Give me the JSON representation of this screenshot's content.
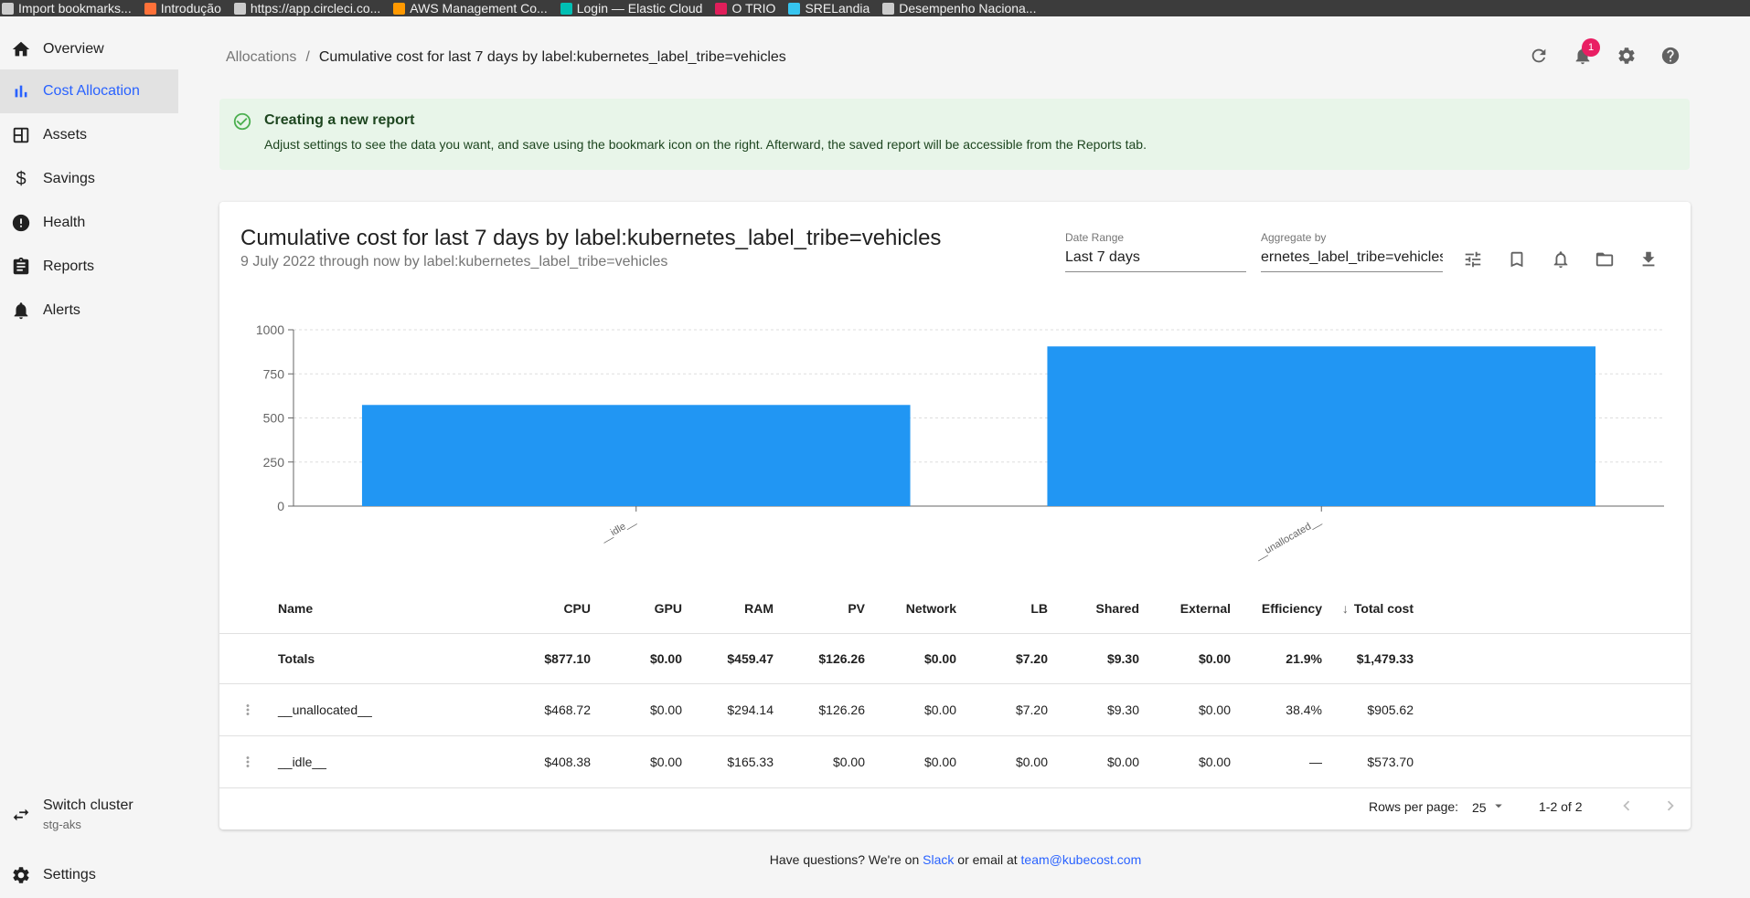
{
  "bookmarks": [
    {
      "label": "Import bookmarks...",
      "icon": "import-icon",
      "color": "#cccccc"
    },
    {
      "label": "Introdução",
      "icon": "firefox-icon",
      "color": "#ff7139"
    },
    {
      "label": "https://app.circleci.co...",
      "icon": "globe-icon",
      "color": "#cccccc"
    },
    {
      "label": "AWS Management Co...",
      "icon": "aws-icon",
      "color": "#ff9900"
    },
    {
      "label": "Login — Elastic Cloud",
      "icon": "elastic-icon",
      "color": "#00bfb3"
    },
    {
      "label": "O TRIO",
      "icon": "slack-icon",
      "color": "#e01e5a"
    },
    {
      "label": "SRELandia",
      "icon": "slack-icon",
      "color": "#36c5f0"
    },
    {
      "label": "Desempenho Naciona...",
      "icon": "globe-icon",
      "color": "#cccccc"
    }
  ],
  "sidebar": {
    "items": [
      {
        "label": "Overview",
        "icon": "home-icon"
      },
      {
        "label": "Cost Allocation",
        "icon": "bar-chart-icon",
        "active": true
      },
      {
        "label": "Assets",
        "icon": "assets-icon"
      },
      {
        "label": "Savings",
        "icon": "dollar-icon"
      },
      {
        "label": "Health",
        "icon": "alert-circle-icon"
      },
      {
        "label": "Reports",
        "icon": "clipboard-icon"
      },
      {
        "label": "Alerts",
        "icon": "bell-icon"
      }
    ],
    "switch_cluster": {
      "label": "Switch cluster",
      "cluster": "stg-aks"
    },
    "settings_label": "Settings"
  },
  "breadcrumb": {
    "parent": "Allocations",
    "separator": "/",
    "current": "Cumulative cost for last 7 days by label:kubernetes_label_tribe=vehicles"
  },
  "notifications": {
    "count": "1"
  },
  "alert": {
    "title": "Creating a new report",
    "body": "Adjust settings to see the data you want, and save using the bookmark icon on the right. Afterward, the saved report will be accessible from the Reports tab."
  },
  "report": {
    "title": "Cumulative cost for last 7 days by label:kubernetes_label_tribe=vehicles",
    "subtitle": "9 July 2022 through now by label:kubernetes_label_tribe=vehicles",
    "date_range": {
      "label": "Date Range",
      "value": "Last 7 days"
    },
    "aggregate": {
      "label": "Aggregate by",
      "value": "ernetes_label_tribe=vehicles"
    }
  },
  "chart_data": {
    "type": "bar",
    "categories": [
      "__idle__",
      "__unallocated__"
    ],
    "values": [
      573.7,
      905.62
    ],
    "ylim": [
      0,
      1000
    ],
    "yticks": [
      "0",
      "250",
      "500",
      "750",
      "1000"
    ],
    "ytick_values": [
      0,
      250,
      500,
      750,
      1000
    ],
    "grid": true,
    "bar_color": "#2196f3"
  },
  "table": {
    "columns": [
      "Name",
      "CPU",
      "GPU",
      "RAM",
      "PV",
      "Network",
      "LB",
      "Shared",
      "External",
      "Efficiency",
      "Total cost"
    ],
    "totals": [
      "Totals",
      "$877.10",
      "$0.00",
      "$459.47",
      "$126.26",
      "$0.00",
      "$7.20",
      "$9.30",
      "$0.00",
      "21.9%",
      "$1,479.33"
    ],
    "rows": [
      [
        "__unallocated__",
        "$468.72",
        "$0.00",
        "$294.14",
        "$126.26",
        "$0.00",
        "$7.20",
        "$9.30",
        "$0.00",
        "38.4%",
        "$905.62"
      ],
      [
        "__idle__",
        "$408.38",
        "$0.00",
        "$165.33",
        "$0.00",
        "$0.00",
        "$0.00",
        "$0.00",
        "$0.00",
        "—",
        "$573.70"
      ]
    ],
    "sort_indicator": "↓"
  },
  "pagination": {
    "rows_per_page_label": "Rows per page:",
    "rows_per_page": "25",
    "range": "1-2 of 2"
  },
  "footer": {
    "prefix": "Have questions? We're on",
    "slack": "Slack",
    "middle": "or email at",
    "email": "team@kubecost.com"
  }
}
